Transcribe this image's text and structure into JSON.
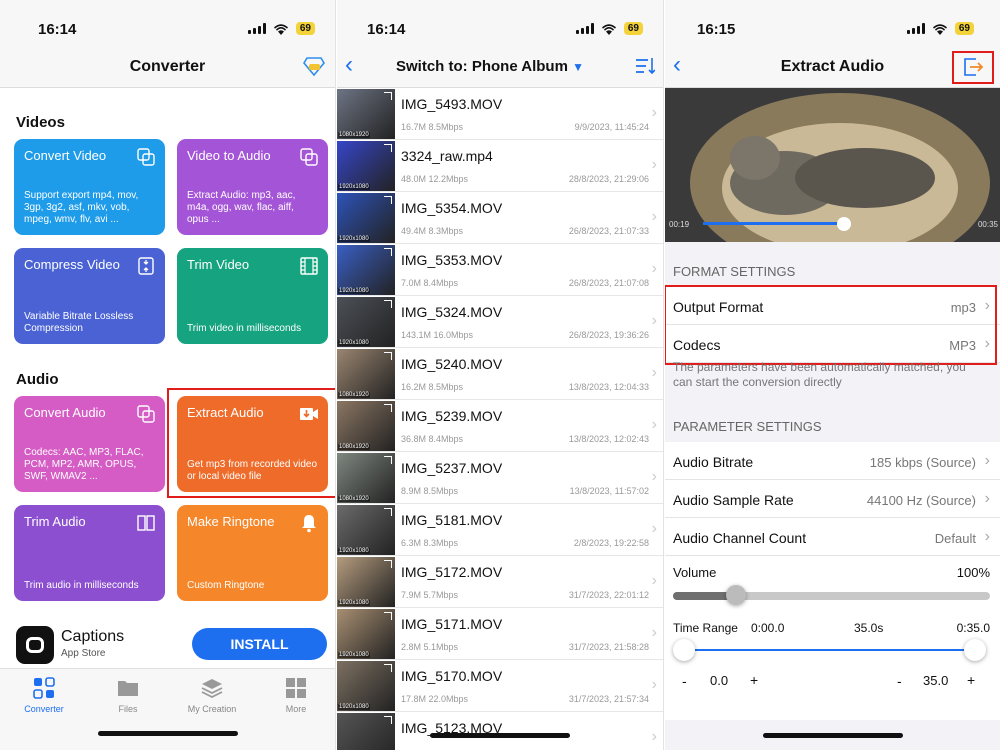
{
  "status": {
    "time1": "16:14",
    "time2": "16:14",
    "time3": "16:15",
    "battery": "69"
  },
  "converter": {
    "title": "Converter",
    "videos_label": "Videos",
    "audio_label": "Audio",
    "cards": [
      {
        "title": "Convert Video",
        "desc": "Support export mp4, mov, 3gp, 3g2, asf, mkv, vob, mpeg, wmv, flv, avi ...",
        "color": "#1e9be9"
      },
      {
        "title": "Video to Audio",
        "desc": "Extract Audio: mp3, aac, m4a, ogg, wav, flac, aiff, opus ...",
        "color": "#a454d6"
      },
      {
        "title": "Compress Video",
        "desc": "Variable Bitrate Lossless Compression",
        "color": "#4a62d4"
      },
      {
        "title": "Trim Video",
        "desc": "Trim video in milliseconds",
        "color": "#16a37f"
      },
      {
        "title": "Convert Audio",
        "desc": "Codecs: AAC, MP3, FLAC, PCM, MP2, AMR, OPUS, SWF, WMAV2 ...",
        "color": "#d55cc4"
      },
      {
        "title": "Extract Audio",
        "desc": "Get mp3 from recorded video or local video file",
        "color": "#ee6b2a"
      },
      {
        "title": "Trim Audio",
        "desc": "Trim audio in milliseconds",
        "color": "#8c4fd0"
      },
      {
        "title": "Make Ringtone",
        "desc": "Custom Ringtone",
        "color": "#f5862a"
      }
    ],
    "ad": {
      "title": "Captions",
      "subtitle": "App Store",
      "install": "INSTALL"
    },
    "tabs": [
      "Converter",
      "Files",
      "My Creation",
      "More"
    ]
  },
  "album": {
    "title": "Switch to: Phone Album",
    "files": [
      {
        "name": "IMG_5493.MOV",
        "size": "16.7M 8.5Mbps",
        "date": "9/9/2023, 11:45:24",
        "res": "1080x1920",
        "color": "#6d7484"
      },
      {
        "name": "3324_raw.mp4",
        "size": "48.0M 12.2Mbps",
        "date": "28/8/2023, 21:29:06",
        "res": "1920x1080",
        "color": "#3646c8"
      },
      {
        "name": "IMG_5354.MOV",
        "size": "49.4M 8.3Mbps",
        "date": "26/8/2023, 21:07:33",
        "res": "1920x1080",
        "color": "#2e53b9"
      },
      {
        "name": "IMG_5353.MOV",
        "size": "7.0M 8.4Mbps",
        "date": "26/8/2023, 21:07:08",
        "res": "1920x1080",
        "color": "#3a5fc4"
      },
      {
        "name": "IMG_5324.MOV",
        "size": "143.1M 16.0Mbps",
        "date": "26/8/2023, 19:36:26",
        "res": "1920x1080",
        "color": "#4c5057"
      },
      {
        "name": "IMG_5240.MOV",
        "size": "16.2M 8.5Mbps",
        "date": "13/8/2023, 12:04:33",
        "res": "1080x1920",
        "color": "#9a8570"
      },
      {
        "name": "IMG_5239.MOV",
        "size": "36.8M 8.4Mbps",
        "date": "13/8/2023, 12:02:43",
        "res": "1080x1920",
        "color": "#8b7663"
      },
      {
        "name": "IMG_5237.MOV",
        "size": "8.9M 8.5Mbps",
        "date": "13/8/2023, 11:57:02",
        "res": "1080x1920",
        "color": "#7f8780"
      },
      {
        "name": "IMG_5181.MOV",
        "size": "6.3M 8.3Mbps",
        "date": "2/8/2023, 19:22:58",
        "res": "1920x1080",
        "color": "#6b6b6b"
      },
      {
        "name": "IMG_5172.MOV",
        "size": "7.9M 5.7Mbps",
        "date": "31/7/2023, 22:01:12",
        "res": "1920x1080",
        "color": "#b59c7e"
      },
      {
        "name": "IMG_5171.MOV",
        "size": "2.8M 5.1Mbps",
        "date": "31/7/2023, 21:58:28",
        "res": "1920x1080",
        "color": "#a88f72"
      },
      {
        "name": "IMG_5170.MOV",
        "size": "17.8M 22.0Mbps",
        "date": "31/7/2023, 21:57:34",
        "res": "1920x1080",
        "color": "#7d7062"
      },
      {
        "name": "IMG_5123.MOV",
        "size": "",
        "date": "",
        "res": "",
        "color": "#555"
      }
    ]
  },
  "extract": {
    "title": "Extract Audio",
    "video_start": "00:19",
    "video_end": "00:35",
    "format_settings": "FORMAT SETTINGS",
    "output_format_label": "Output Format",
    "output_format_value": "mp3",
    "codecs_label": "Codecs",
    "codecs_value": "MP3",
    "note": "The parameters have been automatically matched, you can start the conversion directly",
    "parameter_settings": "PARAMETER SETTINGS",
    "params": [
      {
        "label": "Audio Bitrate",
        "value": "185 kbps (Source)"
      },
      {
        "label": "Audio Sample Rate",
        "value": "44100 Hz (Source)"
      },
      {
        "label": "Audio Channel Count",
        "value": "Default"
      }
    ],
    "volume_label": "Volume",
    "volume_value": "100%",
    "volume_level": 0.2,
    "time_range_label": "Time Range",
    "range_start": "0:00.0",
    "range_mid": "35.0s",
    "range_end": "0:35.0",
    "left_minus": "-",
    "left_value": "0.0",
    "left_plus": "+",
    "right_minus": "-",
    "right_value": "35.0",
    "right_plus": "+"
  }
}
